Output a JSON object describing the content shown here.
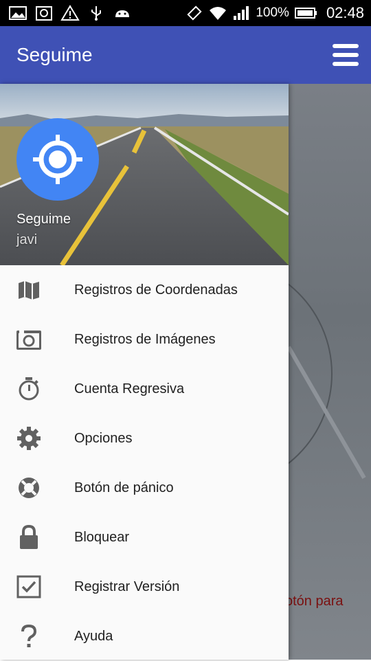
{
  "status_bar": {
    "battery": "100%",
    "time": "02:48"
  },
  "toolbar": {
    "title": "Seguime"
  },
  "drawer": {
    "header": {
      "app_name": "Seguime",
      "user": "javi"
    },
    "items": [
      {
        "label": "Registros de Coordenadas",
        "icon": "map-icon"
      },
      {
        "label": "Registros de Imágenes",
        "icon": "camera-icon"
      },
      {
        "label": "Cuenta Regresiva",
        "icon": "timer-icon"
      },
      {
        "label": "Opciones",
        "icon": "gear-icon"
      },
      {
        "label": "Botón de pánico",
        "icon": "lifebuoy-icon"
      },
      {
        "label": "Bloquear",
        "icon": "lock-icon"
      },
      {
        "label": "Registrar Versión",
        "icon": "checkbox-icon"
      },
      {
        "label": "Ayuda",
        "icon": "help-icon"
      }
    ]
  },
  "background": {
    "partial_text": "otón para"
  },
  "colors": {
    "primary": "#3f51b5",
    "avatar": "#4285f4",
    "icon": "#616161"
  }
}
